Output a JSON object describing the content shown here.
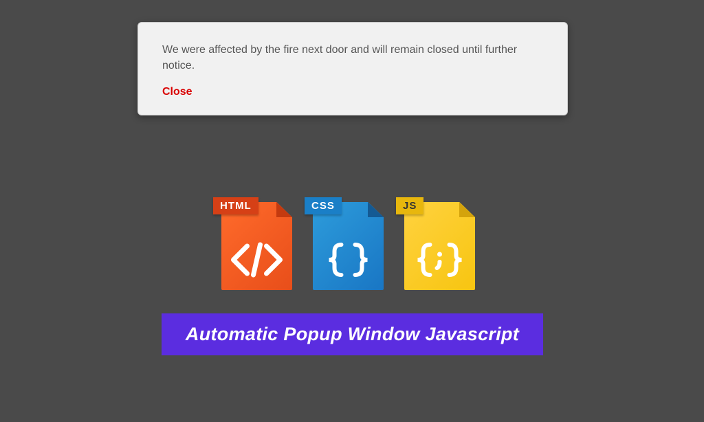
{
  "popup": {
    "message": "We were affected by the fire next door and will remain closed until further notice.",
    "close_label": "Close"
  },
  "files": {
    "html": {
      "label": "HTML"
    },
    "css": {
      "label": "CSS"
    },
    "js": {
      "label": "JS"
    }
  },
  "banner": {
    "title": "Automatic Popup Window Javascript"
  }
}
